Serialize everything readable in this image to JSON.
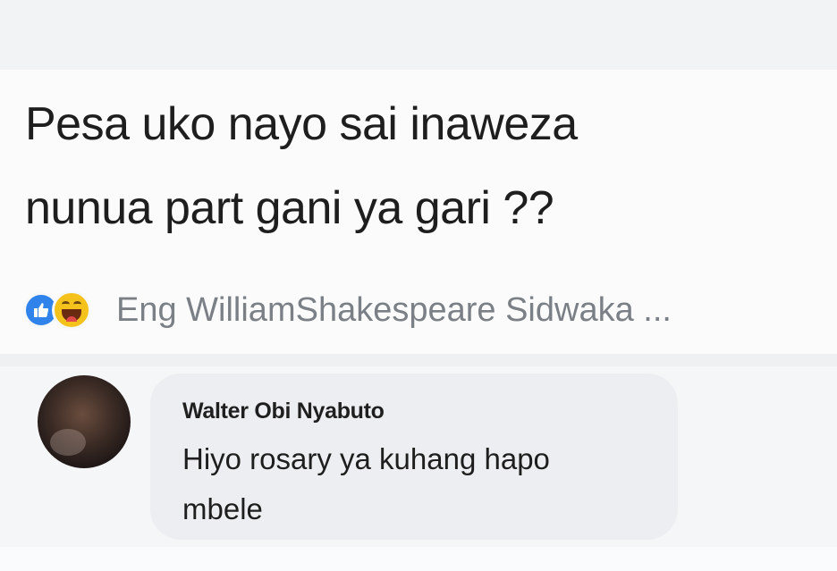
{
  "post": {
    "text_line1": "Pesa uko nayo sai inaweza",
    "text_line2": "nunua part gani ya gari ??"
  },
  "reactions": {
    "icons": [
      "like-icon",
      "haha-icon"
    ],
    "names": "Eng WilliamShakespeare Sidwaka ..."
  },
  "comment": {
    "author": "Walter Obi Nyabuto",
    "text_line1": "Hiyo rosary ya kuhang hapo",
    "text_line2": "mbele"
  },
  "colors": {
    "like": "#2f83ea",
    "haha": "#f4c21a",
    "muted_text": "#7b8087",
    "bubble": "#eceef1"
  }
}
